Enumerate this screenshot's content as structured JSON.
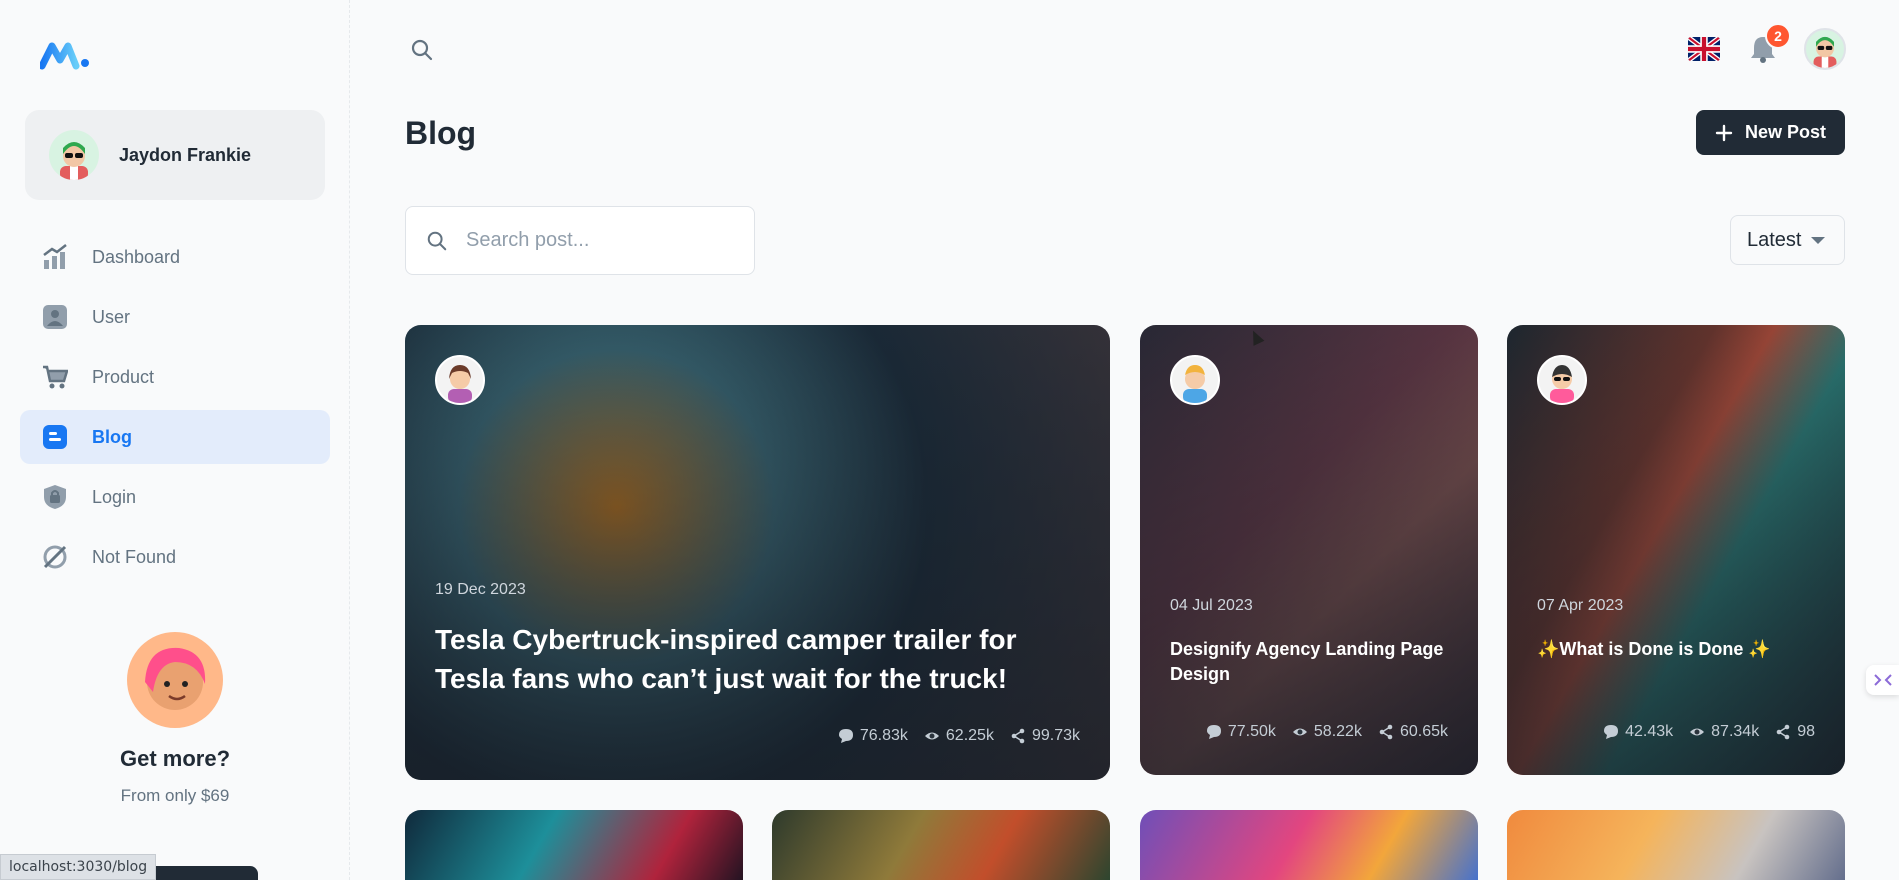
{
  "sidebar": {
    "account_name": "Jaydon Frankie",
    "nav": [
      {
        "label": "Dashboard",
        "icon": "chart-icon"
      },
      {
        "label": "User",
        "icon": "user-icon"
      },
      {
        "label": "Product",
        "icon": "cart-icon"
      },
      {
        "label": "Blog",
        "icon": "blog-icon"
      },
      {
        "label": "Login",
        "icon": "lock-icon"
      },
      {
        "label": "Not Found",
        "icon": "disabled-icon"
      }
    ],
    "promo_title": "Get more?",
    "promo_sub": "From only $69"
  },
  "header": {
    "notification_count": "2",
    "language": "English (UK flag)"
  },
  "page": {
    "title": "Blog",
    "new_post_label": "New Post",
    "search_placeholder": "Search post...",
    "sort_value": "Latest"
  },
  "posts": [
    {
      "date": "19 Dec 2023",
      "title": "Tesla Cybertruck-inspired camper trailer for Tesla fans who can’t just wait for the truck!",
      "comments": "76.83k",
      "views": "62.25k",
      "shares": "99.73k"
    },
    {
      "date": "04 Jul 2023",
      "title": "Designify Agency Landing Page Design",
      "comments": "77.50k",
      "views": "58.22k",
      "shares": "60.65k"
    },
    {
      "date": "07 Apr 2023",
      "title": "✨What is Done is Done ✨",
      "comments": "42.43k",
      "views": "87.34k",
      "shares": "98"
    }
  ],
  "status_url": "localhost:3030/blog",
  "colors": {
    "primary": "#1877f2",
    "dark": "#212b36",
    "badge": "#ff5630"
  }
}
